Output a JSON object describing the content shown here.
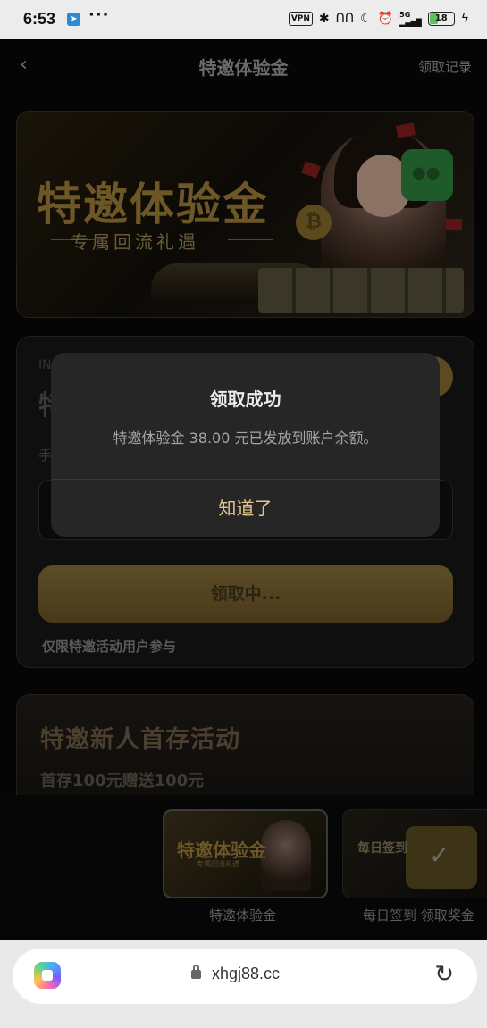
{
  "status_bar": {
    "time": "6:53",
    "notification_icons": [
      "telegram-icon",
      "more-dots"
    ],
    "vpn": "VPN",
    "network": "5G",
    "battery": "18"
  },
  "nav": {
    "title": "特邀体验金",
    "records_link": "领取记录"
  },
  "banner": {
    "title": "特邀体验金",
    "subtitle": "专属回流礼遇"
  },
  "claim_card": {
    "obscured_label": "IN",
    "obscured_heading": "特",
    "phone_label": "手",
    "claim_button": "领取中...",
    "note": "仅限特邀活动用户参与"
  },
  "promo_card": {
    "title": "特邀新人首存活动",
    "subtitle": "首存100元赠送100元"
  },
  "bottom_tabs": [
    {
      "thumb_title": "特邀体验金",
      "thumb_sub": "专属回流礼遇",
      "label": "特邀体验金"
    },
    {
      "thumb_title": "每日签到",
      "label": "每日签到 领取奖金"
    }
  ],
  "modal": {
    "title": "领取成功",
    "message": "特邀体验金 38.00 元已发放到账户余额。",
    "confirm": "知道了"
  },
  "browser": {
    "url": "xhgj88.cc"
  },
  "colors": {
    "gold": "#e2c78a",
    "modal_bg": "#262626"
  }
}
